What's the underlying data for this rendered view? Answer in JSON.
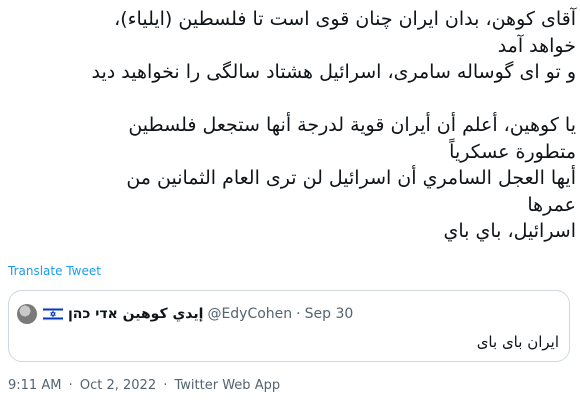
{
  "tweet": {
    "text": "آقای کوهن، بدان ایران چنان قوی است تا فلسطین (ایلیاء)،\nخواهد آمد\nو تو ای گوساله سامری، اسرائیل هشتاد سالگی را نخواهید دید\n\nيا كوهين، أعلم أن أيران قوية لدرجة أنها ستجعل فلسطين\nمتطورة عسكرياً\nأيها العجل السامري أن اسرائيل لن ترى العام الثمانين من\nعمرها\nاسرائيل، باي باي",
    "translate_label": "Translate Tweet"
  },
  "quote": {
    "avatar_icon": "avatar-image",
    "flag_icon": "israel-flag-icon",
    "display_name": "إيدي كوهين אדי כהן",
    "handle": "@EdyCohen",
    "separator": "·",
    "date": "Sep 30",
    "text": "ایران بای بای"
  },
  "meta": {
    "time": "9:11 AM",
    "separator": "·",
    "date": "Oct 2, 2022",
    "source": "Twitter Web App"
  }
}
